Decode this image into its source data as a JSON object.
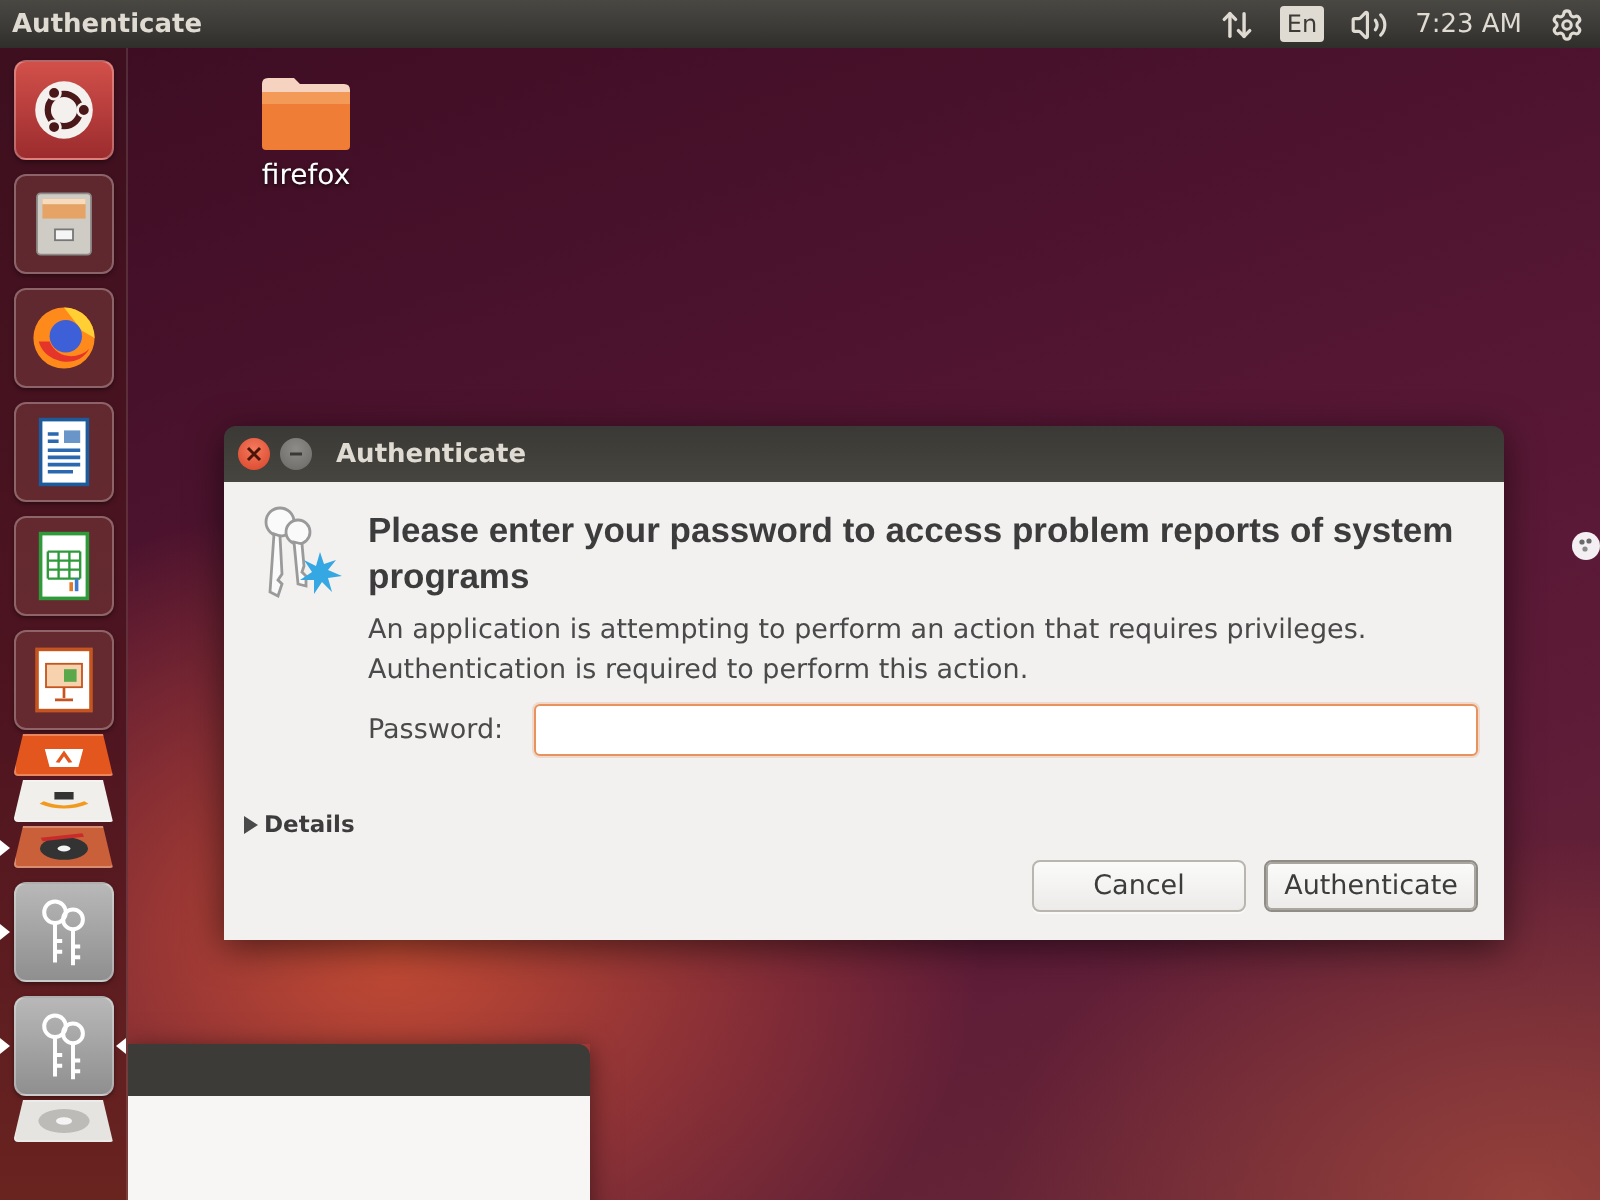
{
  "top_bar": {
    "title": "Authenticate",
    "keyboard_layout": "En",
    "clock": "7:23 AM"
  },
  "launcher": {
    "items": [
      {
        "kind": "dash",
        "folded": false,
        "running": false,
        "selected": false
      },
      {
        "kind": "files",
        "folded": false,
        "running": false,
        "selected": false
      },
      {
        "kind": "browser",
        "folded": false,
        "running": false,
        "selected": false
      },
      {
        "kind": "writer",
        "folded": false,
        "running": false,
        "selected": false
      },
      {
        "kind": "calc",
        "folded": false,
        "running": false,
        "selected": false
      },
      {
        "kind": "impress",
        "folded": false,
        "running": false,
        "selected": false
      },
      {
        "kind": "store",
        "folded": true,
        "running": false,
        "selected": false
      },
      {
        "kind": "shop",
        "folded": true,
        "running": false,
        "selected": false
      },
      {
        "kind": "disc",
        "folded": true,
        "running": true,
        "selected": false
      },
      {
        "kind": "keys",
        "folded": false,
        "running": true,
        "selected": false
      },
      {
        "kind": "keys",
        "folded": false,
        "running": true,
        "selected": true
      },
      {
        "kind": "dvd",
        "folded": true,
        "running": false,
        "selected": false
      }
    ]
  },
  "desktop": {
    "icons": [
      {
        "label": "firefox"
      }
    ]
  },
  "dialog": {
    "title": "Authenticate",
    "heading": "Please enter your password to access problem reports of system programs",
    "message": "An application is attempting to perform an action that requires privileges. Authentication is required to perform this action.",
    "password": {
      "label": "Password:",
      "focused": true
    },
    "details": {
      "label": "Details",
      "expanded": false
    },
    "buttons": [
      {
        "label": "Cancel",
        "default": false
      },
      {
        "label": "Authenticate",
        "default": true
      }
    ]
  }
}
